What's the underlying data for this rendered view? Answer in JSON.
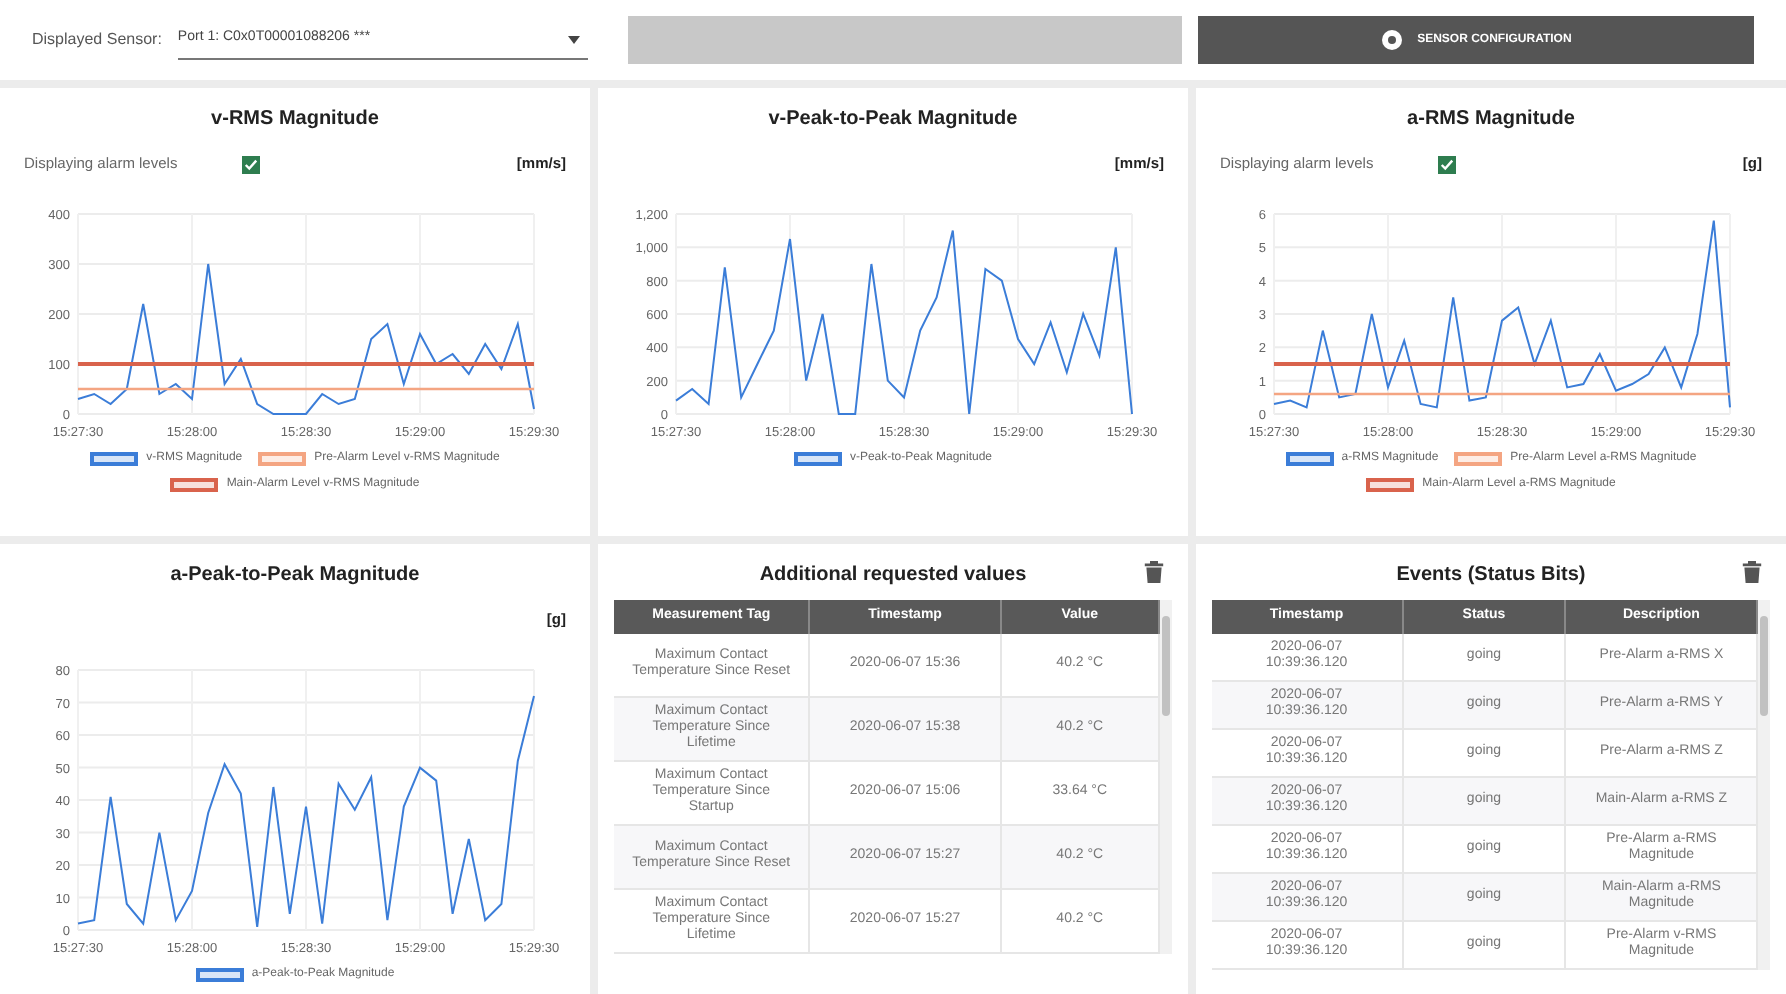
{
  "sensor_select": {
    "label": "Displayed Sensor:",
    "value": "Port 1: C0x0T00001088206 ***"
  },
  "config_button": {
    "label": "SENSOR CONFIGURATION"
  },
  "charts": [
    {
      "title": "v-RMS Magnitude",
      "alarm_toggle": {
        "label": "Displaying alarm levels",
        "checked": true
      },
      "unit": "[mm/s]",
      "chart_data": {
        "type": "line",
        "grid": true,
        "legend": true,
        "categories": [
          "15:27:30",
          null,
          null,
          null,
          null,
          null,
          null,
          "15:28:00",
          null,
          null,
          null,
          null,
          null,
          null,
          "15:28:30",
          null,
          null,
          null,
          null,
          null,
          null,
          "15:29:00",
          null,
          null,
          null,
          null,
          null,
          null,
          "15:29:30"
        ],
        "ylim": [
          0,
          400
        ],
        "yticks": [
          0,
          100,
          200,
          300,
          400
        ],
        "series": [
          {
            "name": "v-RMS Magnitude",
            "color": "#3b7dd8",
            "values": [
              30,
              40,
              20,
              50,
              220,
              40,
              60,
              30,
              300,
              60,
              110,
              20,
              0,
              0,
              0,
              40,
              20,
              30,
              150,
              180,
              60,
              160,
              100,
              120,
              80,
              140,
              90,
              180,
              10
            ]
          },
          {
            "name": "Pre-Alarm Level v-RMS Magnitude",
            "color": "#f4a582",
            "values": [
              50,
              50,
              50,
              50,
              50,
              50,
              50,
              50,
              50,
              50,
              50,
              50,
              50,
              50,
              50,
              50,
              50,
              50,
              50,
              50,
              50,
              50,
              50,
              50,
              50,
              50,
              50,
              50,
              50
            ]
          },
          {
            "name": "Main-Alarm Level v-RMS Magnitude",
            "color": "#d9634c",
            "values": [
              100,
              100,
              100,
              100,
              100,
              100,
              100,
              100,
              100,
              100,
              100,
              100,
              100,
              100,
              100,
              100,
              100,
              100,
              100,
              100,
              100,
              100,
              100,
              100,
              100,
              100,
              100,
              100,
              100
            ]
          }
        ]
      }
    },
    {
      "title": "v-Peak-to-Peak Magnitude",
      "unit": "[mm/s]",
      "chart_data": {
        "type": "line",
        "grid": true,
        "legend": true,
        "categories": [
          "15:27:30",
          null,
          null,
          null,
          null,
          null,
          null,
          "15:28:00",
          null,
          null,
          null,
          null,
          null,
          null,
          "15:28:30",
          null,
          null,
          null,
          null,
          null,
          null,
          "15:29:00",
          null,
          null,
          null,
          null,
          null,
          null,
          "15:29:30"
        ],
        "ylim": [
          0,
          1200
        ],
        "yticks": [
          0,
          200,
          400,
          600,
          800,
          {
            "value": 1000,
            "label": "1,000"
          },
          {
            "value": 1200,
            "label": "1,200"
          }
        ],
        "series": [
          {
            "name": "v-Peak-to-Peak Magnitude",
            "color": "#3b7dd8",
            "values": [
              80,
              150,
              60,
              880,
              100,
              300,
              500,
              1050,
              200,
              600,
              0,
              0,
              900,
              200,
              100,
              500,
              700,
              1100,
              0,
              870,
              800,
              450,
              300,
              550,
              250,
              600,
              350,
              1000,
              0
            ]
          }
        ]
      }
    },
    {
      "title": "a-RMS Magnitude",
      "alarm_toggle": {
        "label": "Displaying alarm levels",
        "checked": true
      },
      "unit": "[g]",
      "chart_data": {
        "type": "line",
        "grid": true,
        "legend": true,
        "categories": [
          "15:27:30",
          null,
          null,
          null,
          null,
          null,
          null,
          "15:28:00",
          null,
          null,
          null,
          null,
          null,
          null,
          "15:28:30",
          null,
          null,
          null,
          null,
          null,
          null,
          "15:29:00",
          null,
          null,
          null,
          null,
          null,
          null,
          "15:29:30"
        ],
        "ylim": [
          0,
          6
        ],
        "yticks": [
          0,
          1,
          2,
          3,
          4,
          5,
          6
        ],
        "series": [
          {
            "name": "a-RMS Magnitude",
            "color": "#3b7dd8",
            "values": [
              0.3,
              0.4,
              0.2,
              2.5,
              0.5,
              0.6,
              3,
              0.8,
              2.2,
              0.3,
              0.2,
              3.5,
              0.4,
              0.5,
              2.8,
              3.2,
              1.5,
              2.8,
              0.8,
              0.9,
              1.8,
              0.7,
              0.9,
              1.2,
              2,
              0.8,
              2.4,
              5.8,
              0.2
            ]
          },
          {
            "name": "Pre-Alarm Level a-RMS Magnitude",
            "color": "#f4a582",
            "values": [
              0.6,
              0.6,
              0.6,
              0.6,
              0.6,
              0.6,
              0.6,
              0.6,
              0.6,
              0.6,
              0.6,
              0.6,
              0.6,
              0.6,
              0.6,
              0.6,
              0.6,
              0.6,
              0.6,
              0.6,
              0.6,
              0.6,
              0.6,
              0.6,
              0.6,
              0.6,
              0.6,
              0.6,
              0.6
            ]
          },
          {
            "name": "Main-Alarm Level a-RMS Magnitude",
            "color": "#d9634c",
            "values": [
              1.5,
              1.5,
              1.5,
              1.5,
              1.5,
              1.5,
              1.5,
              1.5,
              1.5,
              1.5,
              1.5,
              1.5,
              1.5,
              1.5,
              1.5,
              1.5,
              1.5,
              1.5,
              1.5,
              1.5,
              1.5,
              1.5,
              1.5,
              1.5,
              1.5,
              1.5,
              1.5,
              1.5,
              1.5
            ]
          }
        ]
      }
    },
    {
      "title": "a-Peak-to-Peak Magnitude",
      "unit": "[g]",
      "chart_data": {
        "type": "line",
        "grid": true,
        "legend": true,
        "categories": [
          "15:27:30",
          null,
          null,
          null,
          null,
          null,
          null,
          "15:28:00",
          null,
          null,
          null,
          null,
          null,
          null,
          "15:28:30",
          null,
          null,
          null,
          null,
          null,
          null,
          "15:29:00",
          null,
          null,
          null,
          null,
          null,
          null,
          "15:29:30"
        ],
        "ylim": [
          0,
          80
        ],
        "yticks": [
          0,
          10,
          20,
          30,
          40,
          50,
          60,
          70,
          80
        ],
        "series": [
          {
            "name": "a-Peak-to-Peak Magnitude",
            "color": "#3b7dd8",
            "values": [
              2,
              3,
              41,
              8,
              2,
              30,
              3,
              12,
              36,
              51,
              42,
              1,
              44,
              5,
              38,
              2,
              45,
              37,
              47,
              3,
              38,
              50,
              46,
              5,
              28,
              3,
              8,
              52,
              72
            ]
          }
        ]
      }
    }
  ],
  "values_table": {
    "title": "Additional requested values",
    "columns": [
      "Measurement Tag",
      "Timestamp",
      "Value"
    ],
    "rows": [
      [
        "Maximum Contact Temperature Since Reset",
        "2020-06-07 15:36",
        "40.2 °C"
      ],
      [
        "Maximum Contact Temperature Since Lifetime",
        "2020-06-07 15:38",
        "40.2 °C"
      ],
      [
        "Maximum Contact Temperature Since Startup",
        "2020-06-07 15:06",
        "33.64 °C"
      ],
      [
        "Maximum Contact Temperature Since Reset",
        "2020-06-07 15:27",
        "40.2 °C"
      ],
      [
        "Maximum Contact Temperature Since Lifetime",
        "2020-06-07 15:27",
        "40.2 °C"
      ]
    ]
  },
  "events_table": {
    "title": "Events (Status Bits)",
    "columns": [
      "Timestamp",
      "Status",
      "Description"
    ],
    "rows": [
      [
        "2020-06-07 10:39:36.120",
        "going",
        "Pre-Alarm a-RMS X"
      ],
      [
        "2020-06-07 10:39:36.120",
        "going",
        "Pre-Alarm a-RMS Y"
      ],
      [
        "2020-06-07 10:39:36.120",
        "going",
        "Pre-Alarm a-RMS Z"
      ],
      [
        "2020-06-07 10:39:36.120",
        "going",
        "Main-Alarm a-RMS Z"
      ],
      [
        "2020-06-07 10:39:36.120",
        "going",
        "Pre-Alarm a-RMS Magnitude"
      ],
      [
        "2020-06-07 10:39:36.120",
        "going",
        "Main-Alarm a-RMS Magnitude"
      ],
      [
        "2020-06-07 10:39:36.120",
        "going",
        "Pre-Alarm v-RMS Magnitude"
      ]
    ]
  }
}
